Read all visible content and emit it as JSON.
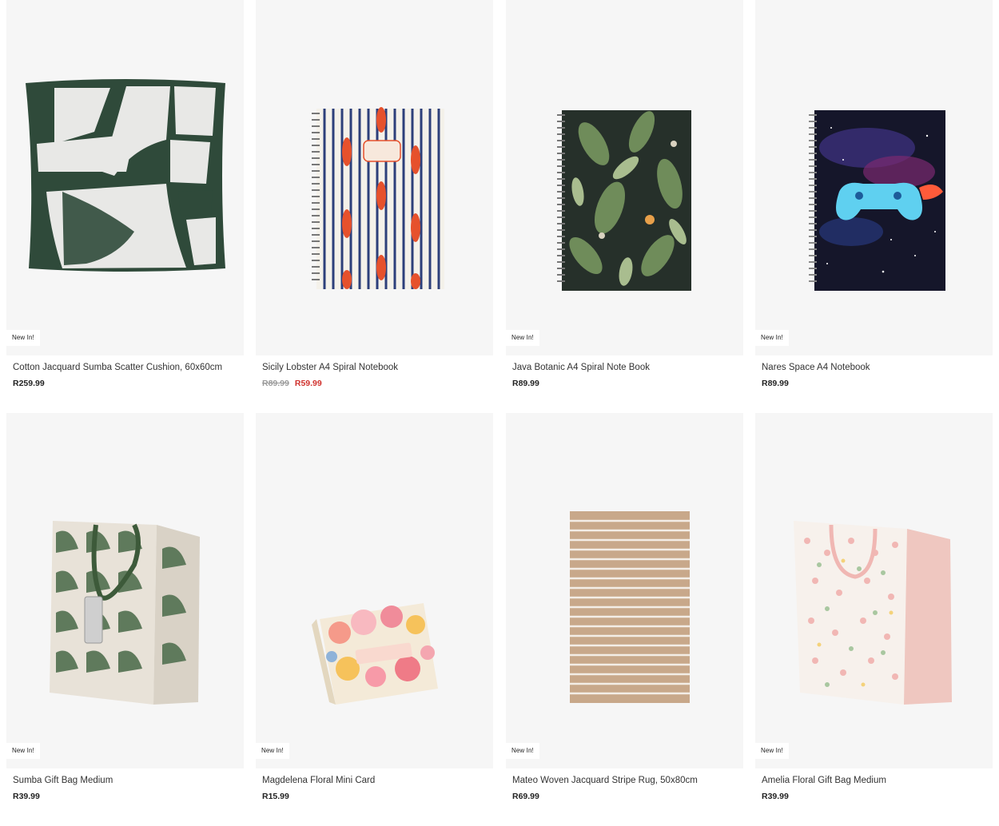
{
  "colors": {
    "card_bg": "#f6f6f6",
    "sale_price": "#d0312d",
    "old_price": "#9a9a9a"
  },
  "products": [
    {
      "image": "cushion-image",
      "badge": "New In!",
      "name": "Cotton Jacquard Sumba Scatter Cushion, 60x60cm",
      "price": "R259.99"
    },
    {
      "image": "lobster-notebook-image",
      "badge": "",
      "name": "Sicily Lobster A4 Spiral Notebook",
      "old_price": "R89.99",
      "price": "R59.99"
    },
    {
      "image": "botanic-notebook-image",
      "badge": "New In!",
      "name": "Java Botanic A4 Spiral Note Book",
      "price": "R89.99"
    },
    {
      "image": "space-notebook-image",
      "badge": "New In!",
      "name": "Nares Space A4 Notebook",
      "price": "R89.99"
    },
    {
      "image": "gift-bag-image",
      "badge": "New In!",
      "name": "Sumba Gift Bag Medium",
      "price": "R39.99"
    },
    {
      "image": "floral-card-image",
      "badge": "New In!",
      "name": "Magdelena Floral Mini Card",
      "price": "R15.99"
    },
    {
      "image": "stripe-rug-image",
      "badge": "New In!",
      "name": "Mateo Woven Jacquard Stripe Rug, 50x80cm",
      "price": "R69.99"
    },
    {
      "image": "floral-gift-bag-image",
      "badge": "New In!",
      "name": "Amelia Floral Gift Bag Medium",
      "price": "R39.99"
    }
  ]
}
